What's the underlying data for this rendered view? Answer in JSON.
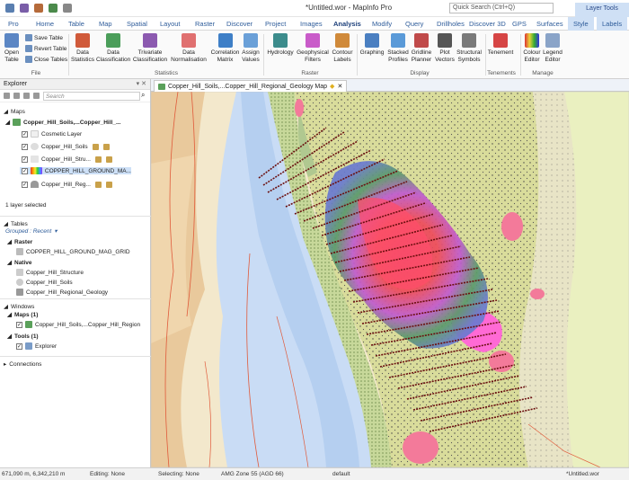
{
  "app": {
    "title": "*Untitled.wor - MapInfo Pro",
    "search_placeholder": "Quick Search (Ctrl+Q)",
    "layer_tools_label": "Layer Tools"
  },
  "ribbon_tabs": [
    "Pro",
    "Home",
    "Table",
    "Map",
    "Spatial",
    "Layout",
    "Raster",
    "Discover",
    "Project",
    "Images",
    "Analysis",
    "Modify",
    "Query",
    "Drillholes",
    "Discover 3D",
    "GPS",
    "Surfaces",
    "Style",
    "Labels"
  ],
  "active_tab": "Analysis",
  "ribbon": {
    "file": {
      "open_table": "Open Table",
      "save_table": "Save Table",
      "revert_table": "Revert Table",
      "close_tables": "Close Tables",
      "group": "File"
    },
    "statistics": {
      "data_statistics": "Data Statistics",
      "data_classification": "Data Classification",
      "trivariate": "Trivariate Classification",
      "data_normalisation": "Data Normalisation",
      "correlation_matrix": "Correlation Matrix",
      "assign_values": "Assign Values",
      "group": "Statistics"
    },
    "raster": {
      "hydrology": "Hydrology",
      "geophysical_filters": "Geophysical Filters",
      "contour_labels": "Contour Labels",
      "group": "Raster"
    },
    "display": {
      "graphing": "Graphing",
      "stacked_profiles": "Stacked Profiles",
      "gridline_planner": "Gridline Planner",
      "plot_vectors": "Plot Vectors",
      "structural_symbols": "Structural Symbols",
      "group": "Display"
    },
    "tenements": {
      "tenement": "Tenement",
      "group": "Tenements"
    },
    "manage": {
      "colour_editor": "Colour Editor",
      "legend_editor": "Legend Editor",
      "group": "Manage"
    }
  },
  "explorer": {
    "title": "Explorer",
    "search_placeholder": "Search",
    "maps_header": "Maps",
    "map_name": "Copper_Hill_Soils,...Copper_Hill_...",
    "layers": [
      "Cosmetic Layer",
      "Copper_Hill_Soils",
      "Copper_Hill_Stru...",
      "COPPER_HILL_GROUND_MA...",
      "Copper_Hill_Reg..."
    ],
    "layer_selected": "1 layer selected",
    "tables_header": "Tables",
    "grouped": "Grouped : Recent",
    "raster_header": "Raster",
    "raster_items": [
      "COPPER_HILL_GROUND_MAG_GRID"
    ],
    "native_header": "Native",
    "native_items": [
      "Copper_Hill_Structure",
      "Copper_Hill_Soils",
      "Copper_Hill_Regional_Geology"
    ],
    "windows_header": "Windows",
    "maps_count": "Maps (1)",
    "map_window": "Copper_Hill_Soils,...Copper_Hill_Region",
    "tools_count": "Tools (1)",
    "tool_item": "Explorer",
    "connections_header": "Connections"
  },
  "map_window": {
    "tab_label": "Copper_Hill_Soils,...Copper_Hill_Regional_Geology Map"
  },
  "status": {
    "coords": "671,090 m, 6,342,210 m",
    "editing": "Editing: None",
    "selecting": "Selecting: None",
    "projection": "AMG Zone 55 (AGD 66)",
    "style": "default",
    "workspace": "*Untitled.wor"
  },
  "colors": {
    "accent": "#2e5c9a",
    "grid_lines": "#6b0f0f",
    "anomaly": "#ff6ad5"
  }
}
